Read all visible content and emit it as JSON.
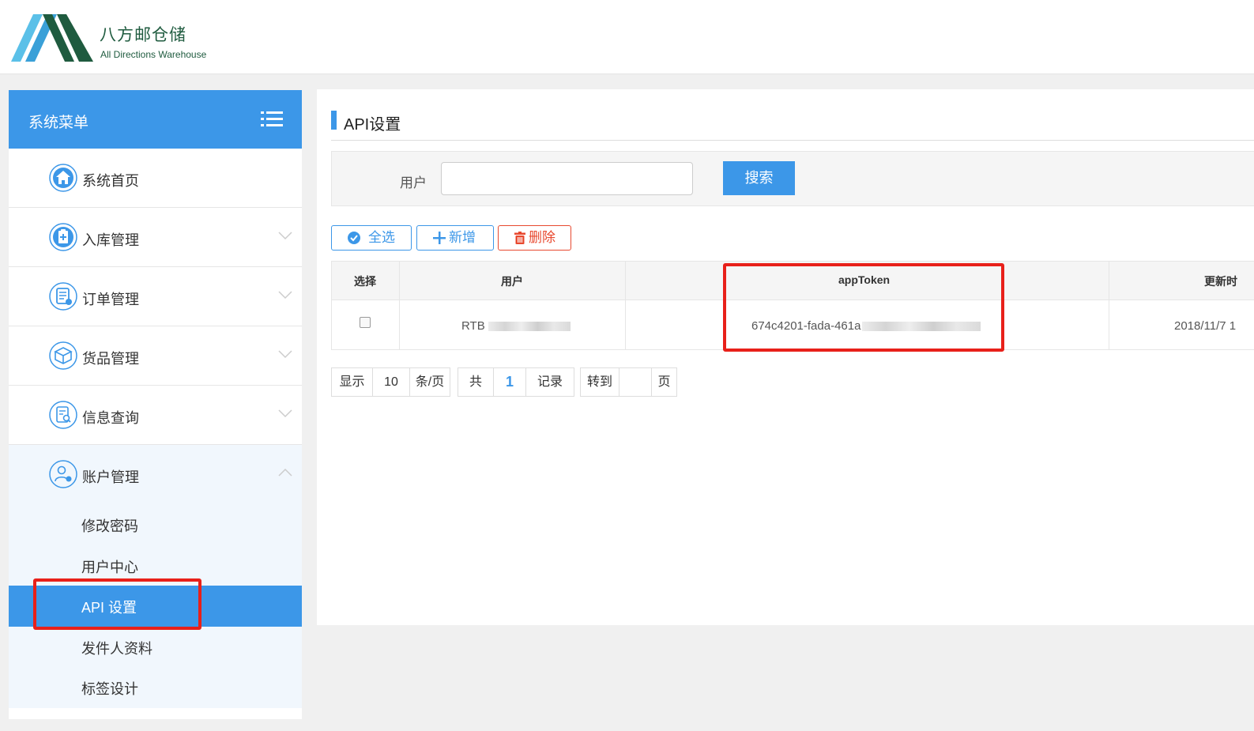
{
  "brand": {
    "name_cn": "八方邮仓储",
    "name_en": "All Directions Warehouse"
  },
  "sidebar": {
    "title": "系统菜单",
    "items": [
      {
        "label": "系统首页",
        "icon": "home-icon"
      },
      {
        "label": "入库管理",
        "icon": "inbound-clipboard-icon"
      },
      {
        "label": "订单管理",
        "icon": "order-list-icon"
      },
      {
        "label": "货品管理",
        "icon": "package-box-icon"
      },
      {
        "label": "信息查询",
        "icon": "document-search-icon"
      },
      {
        "label": "账户管理",
        "icon": "user-account-icon"
      }
    ],
    "account_sub_items": [
      "修改密码",
      "用户中心",
      "API 设置",
      "发件人资料",
      "标签设计"
    ],
    "active_sub_item": "API 设置"
  },
  "page": {
    "title": "API设置",
    "search": {
      "label": "用户",
      "value": "",
      "button": "搜索"
    },
    "toolbar": {
      "select_all": "全选",
      "add": "新增",
      "delete": "删除"
    },
    "table": {
      "headers": [
        "选择",
        "用户",
        "appToken",
        "更新时"
      ],
      "rows": [
        {
          "user": "RTB",
          "app_token": "674c4201-fada-461a",
          "updated": "2018/11/7 1"
        }
      ]
    },
    "pager": {
      "show": "显示",
      "page_size": "10",
      "per_page": "条/页",
      "total_prefix": "共",
      "total": "1",
      "records": "记录",
      "goto": "转到",
      "goto_value": "",
      "page_suffix": "页"
    }
  },
  "colors": {
    "primary": "#3c97e8",
    "danger": "#e8492f",
    "highlight": "#e8201a",
    "brand_green": "#1f5b3f"
  }
}
